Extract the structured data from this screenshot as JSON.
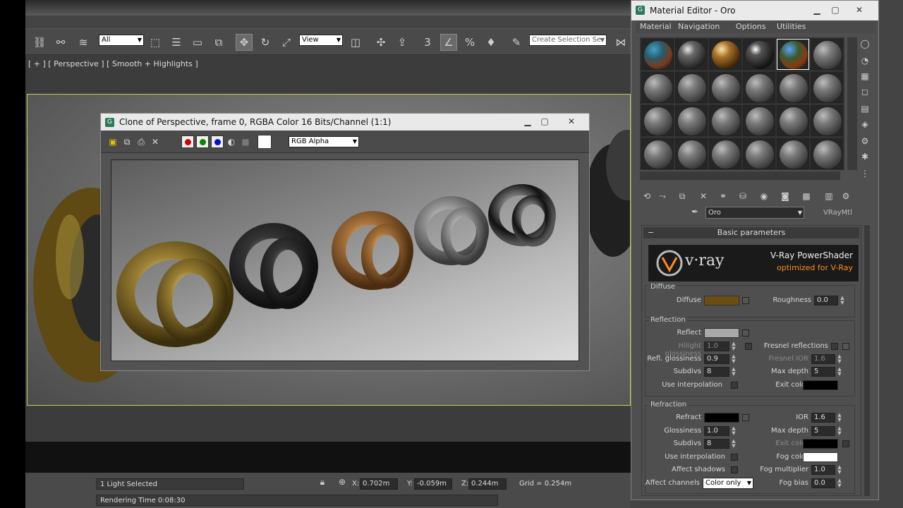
{
  "main_toolbar": {
    "selection_filter": "All",
    "reference_coord": "View",
    "snap_number": "3",
    "named_selection_placeholder": "Create Selection Se"
  },
  "viewport": {
    "label": "[ + ] [ Perspective ] [ Smooth + Highlights ]"
  },
  "status": {
    "selection_info": "1 Light Selected",
    "render_time": "Rendering Time  0:08:30",
    "x_label": "X:",
    "x_value": "0.702m",
    "y_label": "Y:",
    "y_value": "-0.059m",
    "z_label": "Z:",
    "z_value": "0.244m",
    "grid": "Grid = 0.254m"
  },
  "render_window": {
    "title": "Clone of Perspective, frame 0, RGBA Color 16 Bits/Channel (1:1)",
    "channel_display": "RGB Alpha",
    "channel_colors": {
      "red": "#d40000",
      "green": "#008a00",
      "blue": "#0010d8"
    }
  },
  "material_editor": {
    "title": "Material Editor - Oro",
    "menu": [
      "Material",
      "Navigation",
      "Options",
      "Utilities"
    ],
    "material_name": "Oro",
    "material_type": "VRayMtl",
    "rollout_title": "Basic parameters",
    "banner": {
      "logo": "v·ray",
      "headline": "V-Ray PowerShader",
      "subline": "optimized for V-Ray",
      "accent": "#ff8a1e"
    },
    "diffuse": {
      "group": "Diffuse",
      "diffuse_label": "Diffuse",
      "diffuse_color": "#6b4f12",
      "roughness_label": "Roughness",
      "roughness_value": "0.0"
    },
    "reflection": {
      "group": "Reflection",
      "reflect_label": "Reflect",
      "reflect_color": "#a8a8a8",
      "hilight_label": "Hilight glossiness",
      "hilight_value": "1.0",
      "refl_gloss_label": "Refl. glossiness",
      "refl_gloss_value": "0.9",
      "subdivs_label": "Subdivs",
      "subdivs_value": "8",
      "use_interp_label": "Use interpolation",
      "fresnel_label": "Fresnel reflections",
      "fresnel_ior_label": "Fresnel IOR",
      "fresnel_ior_value": "1.6",
      "max_depth_label": "Max depth",
      "max_depth_value": "5",
      "exit_color_label": "Exit color",
      "exit_color": "#000000"
    },
    "refraction": {
      "group": "Refraction",
      "refract_label": "Refract",
      "refract_color": "#000000",
      "ior_label": "IOR",
      "ior_value": "1.6",
      "glossiness_label": "Glossiness",
      "glossiness_value": "1.0",
      "max_depth_label": "Max depth",
      "max_depth_value": "5",
      "subdivs_label": "Subdivs",
      "subdivs_value": "8",
      "exit_color_label": "Exit color",
      "exit_color": "#000000",
      "use_interp_label": "Use interpolation",
      "fog_color_label": "Fog color",
      "fog_color": "#ffffff",
      "affect_shadows_label": "Affect shadows",
      "fog_mult_label": "Fog multiplier",
      "fog_mult_value": "1.0",
      "affect_channels_label": "Affect channels",
      "affect_channels_value": "Color only",
      "fog_bias_label": "Fog bias",
      "fog_bias_value": "0.0"
    }
  }
}
